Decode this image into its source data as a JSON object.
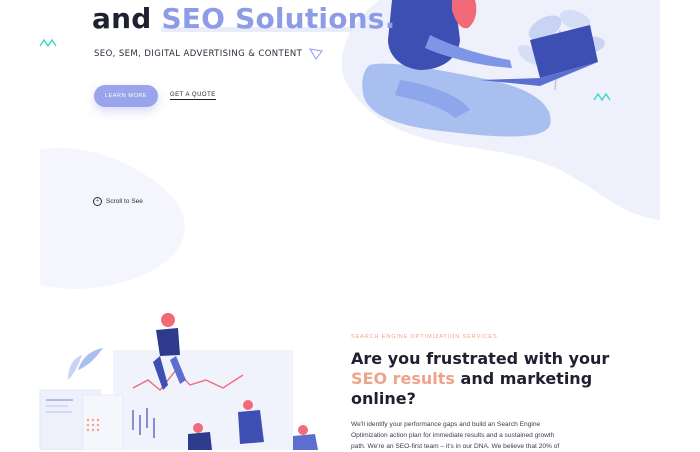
{
  "hero": {
    "title_prefix": "and",
    "title_highlight": "SEO Solutions.",
    "subtitle": "SEO, SEM, DIGITAL ADVERTISING & CONTENT",
    "primary_button": "LEARN MORE",
    "secondary_link": "GET A QUOTE",
    "scroll_label": "Scroll to See"
  },
  "section": {
    "tag": "SEARCH ENGINE OPTIMIZATION SERVICES",
    "title_part1": "Are you frustrated with your",
    "title_accent1": "SEO",
    "title_accent2": "results",
    "title_part2": "and marketing online?",
    "body_line1": "We'll identify your performance gaps and build an Search Engine",
    "body_line2": "Optimization action plan for immediate results and a sustained growth",
    "body_line3": "path. We're an SEO-first team – it's in our DNA. We believe that 20% of"
  },
  "colors": {
    "accent_blue": "#8e9be6",
    "accent_peach": "#f0a38b",
    "teal": "#3fd6c3",
    "dark_text": "#1f2030"
  },
  "icons": {
    "scroll": "circle-plus-icon"
  }
}
